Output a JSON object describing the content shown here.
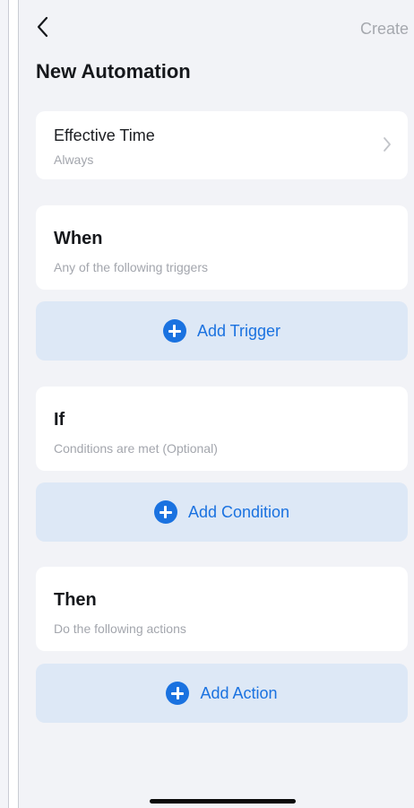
{
  "header": {
    "create_label": "Create"
  },
  "page": {
    "title": "New Automation"
  },
  "effective_time": {
    "label": "Effective Time",
    "value": "Always"
  },
  "sections": {
    "when": {
      "title": "When",
      "subtitle": "Any of the following triggers",
      "button_label": "Add Trigger"
    },
    "if": {
      "title": "If",
      "subtitle": "Conditions are met (Optional)",
      "button_label": "Add Condition"
    },
    "then": {
      "title": "Then",
      "subtitle": "Do the following actions",
      "button_label": "Add Action"
    }
  },
  "icons": {
    "back": "chevron-left-icon",
    "disclosure": "chevron-right-icon",
    "add": "plus-circle-icon"
  },
  "colors": {
    "accent": "#1a72e0",
    "add_button_bg": "#dde8f6",
    "screen_bg": "#f2f3f7",
    "muted_text": "#a3a6ad"
  }
}
